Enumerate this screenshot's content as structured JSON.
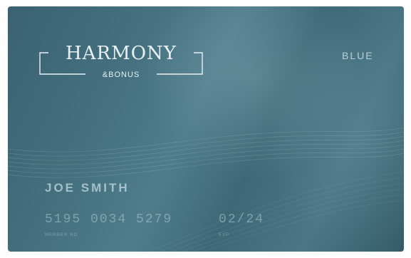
{
  "card": {
    "brand": "HARMONY",
    "brand_sub": "&BONUS",
    "tier": "BLUE",
    "holder_name": "JOE SMITH",
    "member_number": "5195 0034 5279",
    "member_label": "MEMBER NO",
    "expiry": "02/24",
    "expiry_label": "EXP"
  },
  "colors": {
    "card_base": "#44707f",
    "text_light": "#e9f0f2",
    "text_muted": "#b8cfd6"
  },
  "icons": [
    "wave-pattern-icon",
    "logo-frame-icon"
  ]
}
